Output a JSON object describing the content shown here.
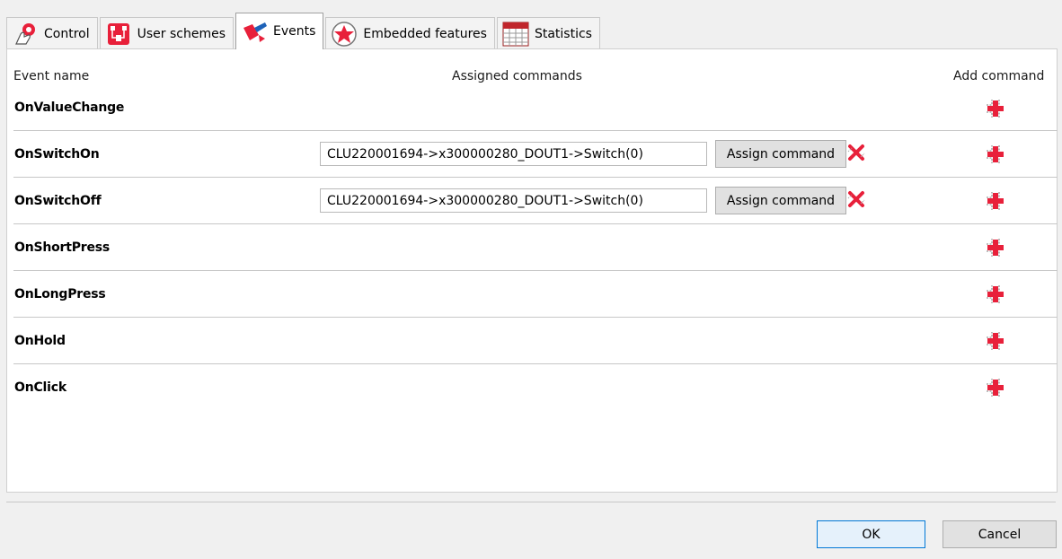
{
  "tabs": [
    {
      "label": "Control",
      "icon": "touch-hand-icon"
    },
    {
      "label": "User schemes",
      "icon": "user-schemes-icon"
    },
    {
      "label": "Events",
      "icon": "events-pen-icon",
      "active": true
    },
    {
      "label": "Embedded features",
      "icon": "star-badge-icon"
    },
    {
      "label": "Statistics",
      "icon": "calendar-table-icon"
    }
  ],
  "table": {
    "col_event_name": "Event name",
    "col_assigned": "Assigned commands",
    "col_add": "Add command",
    "rows": [
      {
        "name": "OnValueChange",
        "command": "",
        "assign_label": ""
      },
      {
        "name": "OnSwitchOn",
        "command": "CLU220001694->x300000280_DOUT1->Switch(0)",
        "assign_label": "Assign command"
      },
      {
        "name": "OnSwitchOff",
        "command": "CLU220001694->x300000280_DOUT1->Switch(0)",
        "assign_label": "Assign command"
      },
      {
        "name": "OnShortPress",
        "command": "",
        "assign_label": ""
      },
      {
        "name": "OnLongPress",
        "command": "",
        "assign_label": ""
      },
      {
        "name": "OnHold",
        "command": "",
        "assign_label": ""
      },
      {
        "name": "OnClick",
        "command": "",
        "assign_label": ""
      }
    ]
  },
  "buttons": {
    "ok": "OK",
    "cancel": "Cancel"
  },
  "colors": {
    "accent_red": "#e8203a",
    "ok_border": "#0078d7"
  }
}
